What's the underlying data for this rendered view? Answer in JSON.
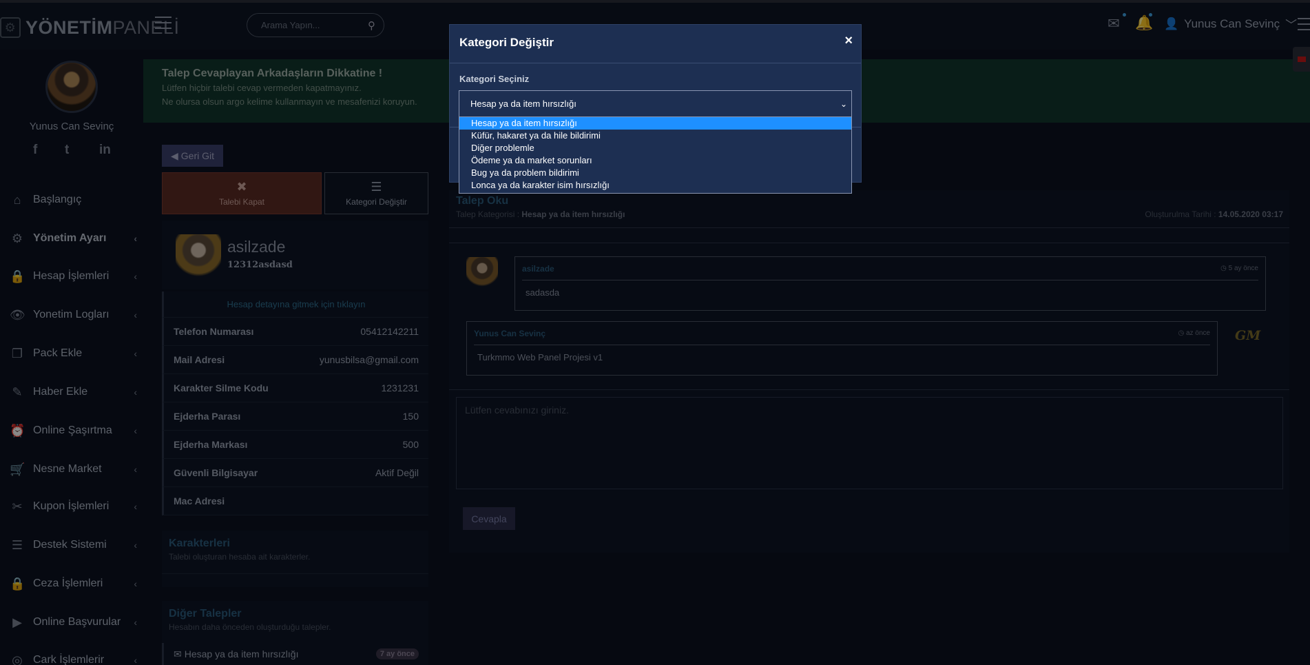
{
  "header": {
    "logo_bold": "YÖNETİM",
    "logo_light": "PANELİ",
    "search_placeholder": "Arama Yapın...",
    "user_name": "Yunus Can Sevinç"
  },
  "sidebar": {
    "user_name": "Yunus Can Sevinç",
    "social": [
      "f",
      "t",
      "in"
    ],
    "items": [
      {
        "label": "Başlangıç",
        "icon": "home-icon",
        "glyph": "⌂",
        "has_chevron": false
      },
      {
        "label": "Yönetim Ayarı",
        "icon": "gear-icon",
        "glyph": "⚙",
        "has_chevron": true
      },
      {
        "label": "Hesap İşlemleri",
        "icon": "lock-icon",
        "glyph": "🔒",
        "has_chevron": true
      },
      {
        "label": "Yonetim Logları",
        "icon": "eye-icon",
        "glyph": "👁",
        "has_chevron": true
      },
      {
        "label": "Pack Ekle",
        "icon": "copy-icon",
        "glyph": "❐",
        "has_chevron": true
      },
      {
        "label": "Haber Ekle",
        "icon": "edit-icon",
        "glyph": "✎",
        "has_chevron": true
      },
      {
        "label": "Online Şaşırtma",
        "icon": "clock-icon",
        "glyph": "⏰",
        "has_chevron": true
      },
      {
        "label": "Nesne Market",
        "icon": "cart-icon",
        "glyph": "🛒",
        "has_chevron": true
      },
      {
        "label": "Kupon İşlemleri",
        "icon": "plug-icon",
        "glyph": "✂",
        "has_chevron": true
      },
      {
        "label": "Destek Sistemi",
        "icon": "chat-icon",
        "glyph": "☰",
        "has_chevron": true
      },
      {
        "label": "Ceza İşlemleri",
        "icon": "lock-icon",
        "glyph": "🔒",
        "has_chevron": true
      },
      {
        "label": "Online Başvurular",
        "icon": "youtube-icon",
        "glyph": "▶",
        "has_chevron": true
      },
      {
        "label": "Cark İşlemlerir",
        "icon": "target-icon",
        "glyph": "◎",
        "has_chevron": true
      }
    ]
  },
  "alert": {
    "title": "Talep Cevaplayan Arkadaşların Dikkatine !",
    "line1": "Lütfen hiçbir talebi cevap vermeden kapatmayınız.",
    "line2": "Ne olursa olsun argo kelime kullanmayın ve mesafenizi koruyun."
  },
  "left_panel": {
    "back_label": "Geri Git",
    "close_label": "Talebi Kapat",
    "category_label": "Kategori Değiştir",
    "profile_name": "asilzade",
    "profile_sub": "12312asdasd",
    "detail_link": "Hesap detayına gitmek için tıklayın",
    "rows": [
      {
        "key": "Telefon Numarası",
        "value": "05412142211"
      },
      {
        "key": "Mail Adresi",
        "value": "yunusbilsa@gmail.com"
      },
      {
        "key": "Karakter Silme Kodu",
        "value": "1231231"
      },
      {
        "key": "Ejderha Parası",
        "value": "150"
      },
      {
        "key": "Ejderha Markası",
        "value": "500"
      },
      {
        "key": "Güvenli Bilgisayar",
        "value": "Aktif Değil"
      },
      {
        "key": "Mac Adresi",
        "value": ""
      }
    ],
    "characters_title": "Karakterleri",
    "characters_sub": "Talebi oluşturan hesaba ait karakterler.",
    "other_title": "Diğer Talepler",
    "other_sub": "Hesabın daha önceden oluşturduğu talepler.",
    "other_item": "Hesap ya da item hırsızlığı",
    "other_item_badge": "7 ay önce"
  },
  "main": {
    "title": "Talep Oku",
    "category_prefix": "Talep Kategorisi : ",
    "category_value": "Hesap ya da item hırsızlığı",
    "created_prefix": "Oluşturulma Tarihi : ",
    "created_value": "14.05.2020 03:17",
    "messages": [
      {
        "author": "asilzade",
        "time": "5 ay önce",
        "body": "sadasda"
      },
      {
        "author": "Yunus Can Sevinç",
        "time": "az önce",
        "body": "Turkmmo Web Panel Projesi v1"
      }
    ],
    "gm_badge": "GM",
    "reply_placeholder": "Lütfen cevabınızı giriniz.",
    "reply_button": "Cevapla"
  },
  "modal": {
    "title": "Kategori Değiştir",
    "close_glyph": "×",
    "label": "Kategori Seçiniz",
    "selected": "Hesap ya da item hırsızlığı",
    "options": [
      "Hesap ya da item hırsızlığı",
      "Küfür, hakaret ya da hile bildirimi",
      "Diğer problemle",
      "Ödeme ya da market sorunları",
      "Bug ya da problem bildirimi",
      "Lonca ya da karakter isim hırsızlığı"
    ]
  },
  "colors": {
    "alert_bg": "#12362d",
    "modal_bg": "#1d2f52",
    "selected_option": "#1e90ff",
    "close_button": "#5a2a24"
  }
}
